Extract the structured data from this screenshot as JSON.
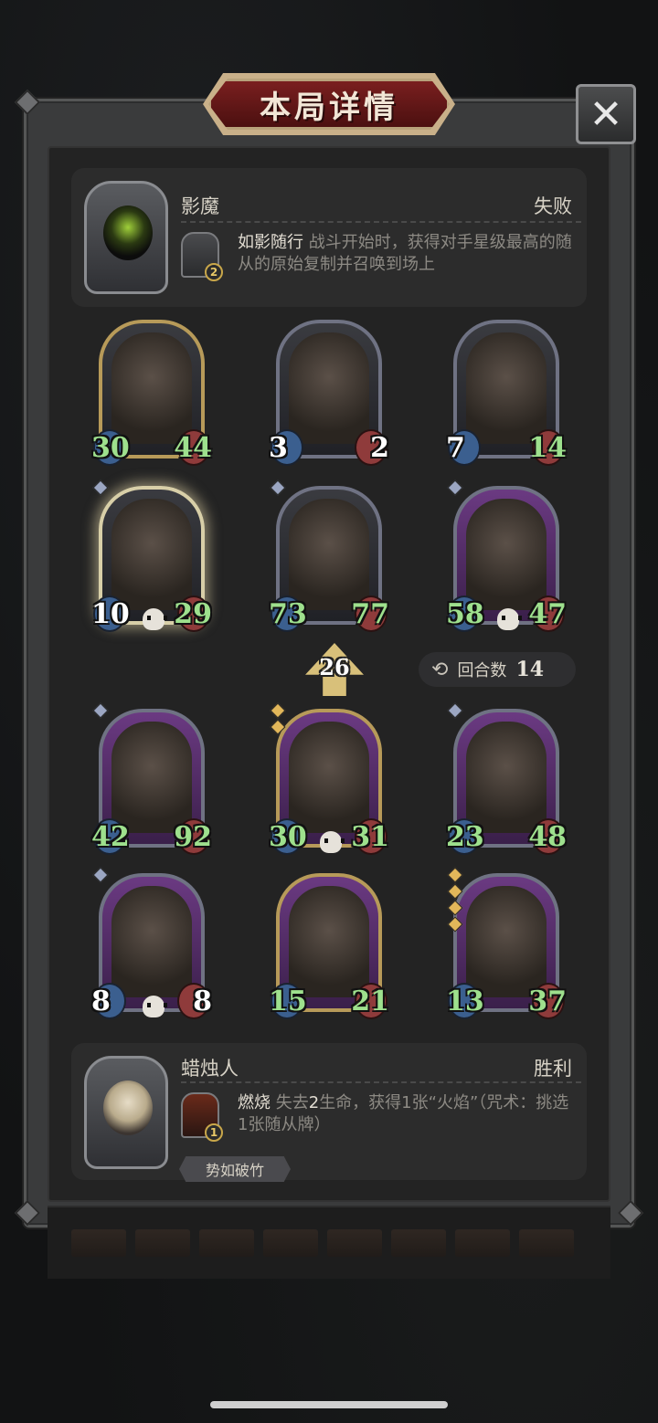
{
  "title": "本局详情",
  "close_symbol": "✕",
  "opponent": {
    "name": "影魔",
    "result": "失败",
    "ability": {
      "name": "如影随行",
      "description": "战斗开始时，获得对手星级最高的随从的原始复制并召唤到场上",
      "level": "2"
    }
  },
  "opponent_board": [
    {
      "attack": "30",
      "health": "44",
      "frame": "gold"
    },
    {
      "attack": "3",
      "health": "2",
      "frame": "silver"
    },
    {
      "attack": "7",
      "health": "14",
      "frame": "silver"
    },
    {
      "attack": "10",
      "health": "29",
      "frame": "glow",
      "stars": 1,
      "skull": true
    },
    {
      "attack": "73",
      "health": "77",
      "frame": "silver",
      "stars": 1
    },
    {
      "attack": "58",
      "health": "47",
      "frame": "purple",
      "stars": 1,
      "skull": true
    }
  ],
  "middle": {
    "level": "26",
    "round_label": "回合数",
    "round_value": "14"
  },
  "player_board": [
    {
      "attack": "42",
      "health": "92",
      "frame": "purple",
      "stars": 1
    },
    {
      "attack": "30",
      "health": "31",
      "frame": "gold-purple",
      "stars": 2,
      "star_color": "gold",
      "skull": true
    },
    {
      "attack": "23",
      "health": "48",
      "frame": "purple",
      "stars": 1
    },
    {
      "attack": "8",
      "health": "8",
      "frame": "purple",
      "stars": 1,
      "skull": true
    },
    {
      "attack": "15",
      "health": "21",
      "frame": "gold-purple"
    },
    {
      "attack": "13",
      "health": "37",
      "frame": "purple",
      "stars": 4,
      "star_color": "gold"
    }
  ],
  "player": {
    "name": "蜡烛人",
    "result": "胜利",
    "ability": {
      "name": "燃烧",
      "description_parts": [
        "失去",
        "2",
        "生命，获得1张“火焰”（咒术：挑选1张随从牌）"
      ],
      "level": "1"
    },
    "tag": "势如破竹"
  }
}
